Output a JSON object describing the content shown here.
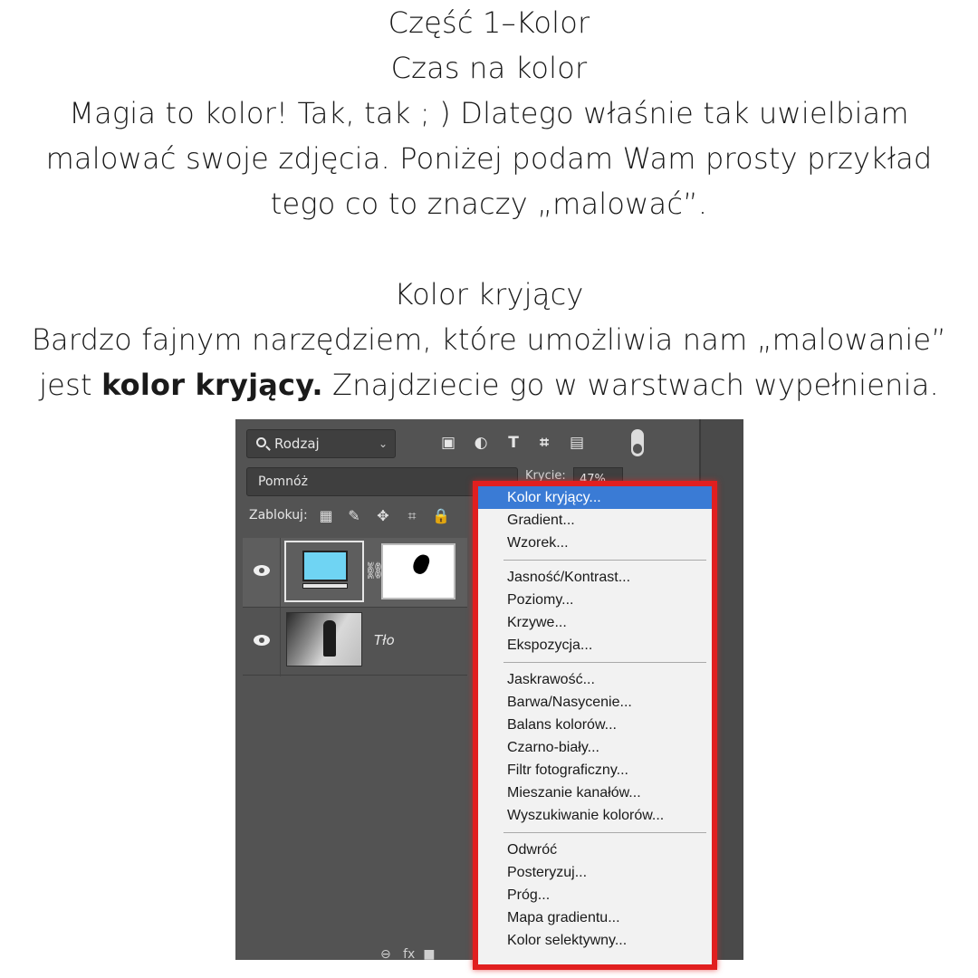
{
  "article": {
    "title": "Część 1–Kolor",
    "subtitle": "Czas na kolor",
    "intro_lines": [
      "Magia to kolor! Tak, tak ; ) Dlatego właśnie tak uwielbiam",
      "malować swoje zdjęcia. Poniżej podam Wam prosty przykład",
      "tego co to znaczy „malować”."
    ],
    "section_title": "Kolor kryjący",
    "body_line1": "Bardzo fajnym narzędziem, które umożliwia nam „malowanie”",
    "body_line2_prefix": "jest ",
    "body_line2_bold": "kolor kryjący.",
    "body_line2_suffix": " Znajdziecie go w warstwach wypełnienia."
  },
  "layers_panel": {
    "kind_filter": "Rodzaj",
    "blend_mode": "Pomnóż",
    "opacity_label": "Krycie:",
    "opacity_value": "47%",
    "lock_label": "Zablokuj:",
    "layers": [
      {
        "name": "",
        "type": "fill-layer"
      },
      {
        "name": "Tło",
        "type": "background"
      }
    ],
    "filter_icons": [
      "image-filter-icon",
      "adjustment-filter-icon",
      "type-filter-icon",
      "shape-filter-icon",
      "smart-object-filter-icon"
    ],
    "lock_icons": [
      "lock-pixels-icon",
      "lock-brush-icon",
      "lock-move-icon",
      "lock-artboard-icon",
      "lock-all-icon"
    ]
  },
  "context_menu": {
    "groups": [
      [
        "Kolor kryjący...",
        "Gradient...",
        "Wzorek..."
      ],
      [
        "Jasność/Kontrast...",
        "Poziomy...",
        "Krzywe...",
        "Ekspozycja..."
      ],
      [
        "Jaskrawość...",
        "Barwa/Nasycenie...",
        "Balans kolorów...",
        "Czarno-biały...",
        "Filtr fotograficzny...",
        "Mieszanie kanałów...",
        "Wyszukiwanie kolorów..."
      ],
      [
        "Odwróć",
        "Posteryzuj...",
        "Próg...",
        "Mapa gradientu...",
        "Kolor selektywny..."
      ]
    ],
    "selected": "Kolor kryjący...",
    "highlight_color": "#3a7bd5",
    "outline_color": "#e11f1f"
  },
  "colors": {
    "panel_bg": "#535353",
    "fill_thumb": "#6fd4f3"
  }
}
